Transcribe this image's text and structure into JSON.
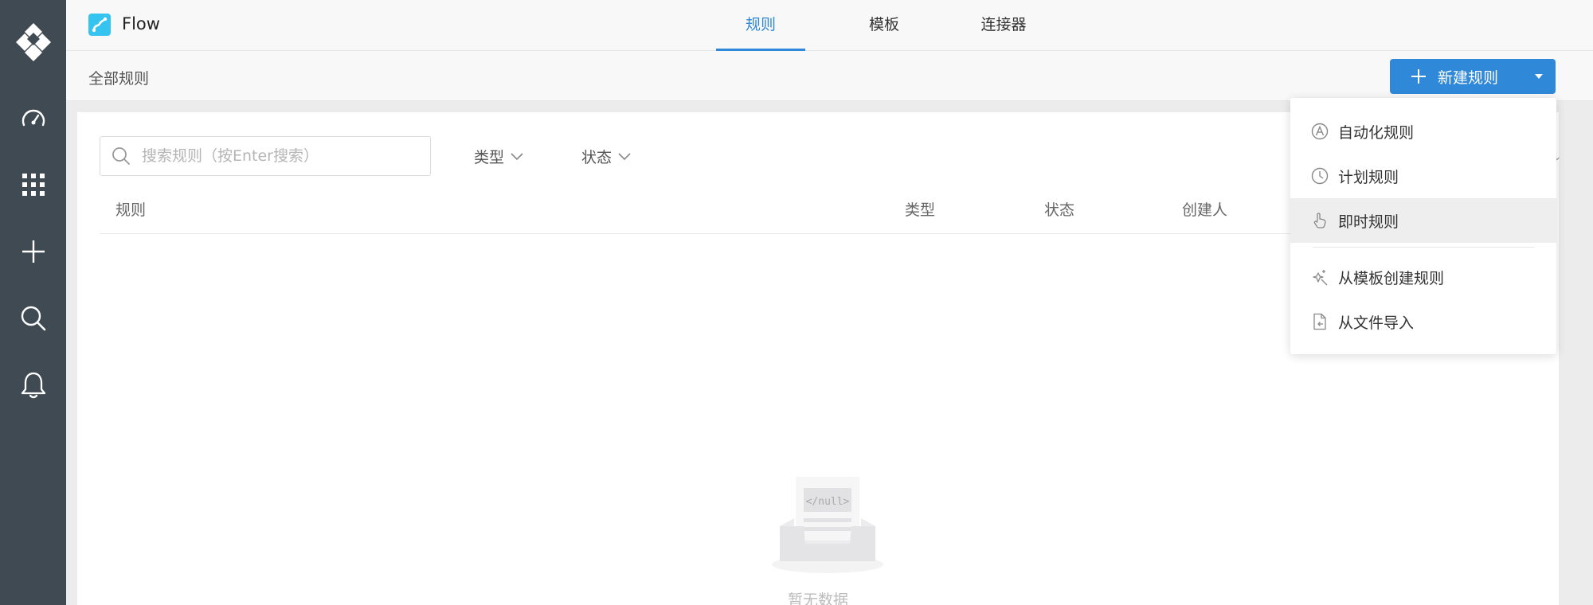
{
  "app": {
    "name": "Flow"
  },
  "tabs": [
    {
      "label": "规则",
      "active": true
    },
    {
      "label": "模板",
      "active": false
    },
    {
      "label": "连接器",
      "active": false
    }
  ],
  "subbar": {
    "title": "全部规则",
    "new_button_label": "新建规则"
  },
  "search": {
    "placeholder": "搜索规则（按Enter搜索）",
    "value": ""
  },
  "filters": {
    "type_label": "类型",
    "status_label": "状态"
  },
  "table": {
    "columns": [
      "规则",
      "类型",
      "状态",
      "创建人"
    ]
  },
  "empty": {
    "text": "暂无数据",
    "illustration_text": "</null>"
  },
  "dropdown": {
    "items": [
      "自动化规则",
      "计划规则",
      "即时规则",
      "从模板创建规则",
      "从文件导入"
    ],
    "hovered_index": 2
  },
  "rail": {
    "icons": [
      "logo-icon",
      "dashboard-icon",
      "apps-grid-icon",
      "add-icon",
      "search-icon",
      "bell-icon"
    ]
  },
  "colors": {
    "rail_bg": "#404a53",
    "accent": "#2f88d8",
    "logo": "#35c3f0"
  }
}
